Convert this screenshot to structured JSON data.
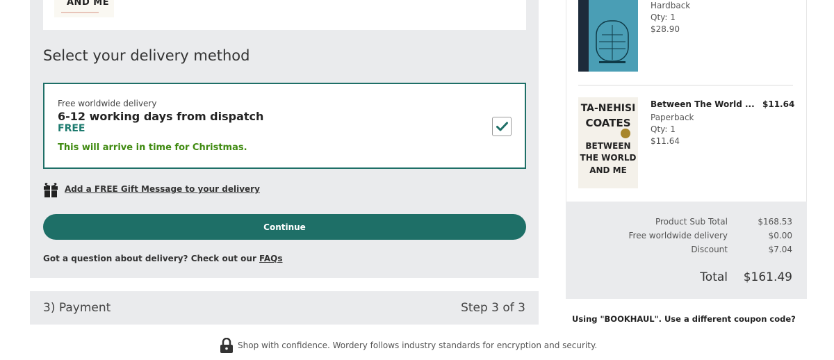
{
  "top_item": {
    "cover_text": "AND ME"
  },
  "delivery": {
    "section_title": "Select your delivery method",
    "option": {
      "subtitle": "Free worldwide delivery",
      "title": "6-12 working days from dispatch",
      "price": "FREE",
      "note": "This will arrive in time for Christmas.",
      "selected": true
    },
    "gift_link": "Add a FREE Gift Message to your delivery",
    "continue_label": "Continue",
    "faq_prefix": "Got a question about delivery? Check out our ",
    "faq_link": "FAQs"
  },
  "payment": {
    "label": "3) Payment",
    "step": "Step 3 of 3"
  },
  "security_note": "Shop with confidence. Wordery follows industry standards for encryption and security.",
  "basket": {
    "items": [
      {
        "format": "Hardback",
        "qty": "Qty: 1",
        "price": "$28.90"
      },
      {
        "title": "Between The World ...",
        "price": "$11.64",
        "format": "Paperback",
        "qty": "Qty: 1",
        "unit_price": "$11.64",
        "cover_lines": [
          "TA-NEHISI",
          "COATES",
          "BETWEEN",
          "THE WORLD",
          "AND ME"
        ]
      }
    ],
    "totals": {
      "subtotal_label": "Product Sub Total",
      "subtotal": "$168.53",
      "delivery_label": "Free worldwide delivery",
      "delivery": "$0.00",
      "discount_label": "Discount",
      "discount": "$7.04",
      "total_label": "Total",
      "total": "$161.49"
    },
    "coupon_note": "Using \"BOOKHAUL\". Use a different coupon code?"
  },
  "colors": {
    "accent": "#1e6f67",
    "success": "#3f8a10",
    "panel": "#eaebed"
  }
}
